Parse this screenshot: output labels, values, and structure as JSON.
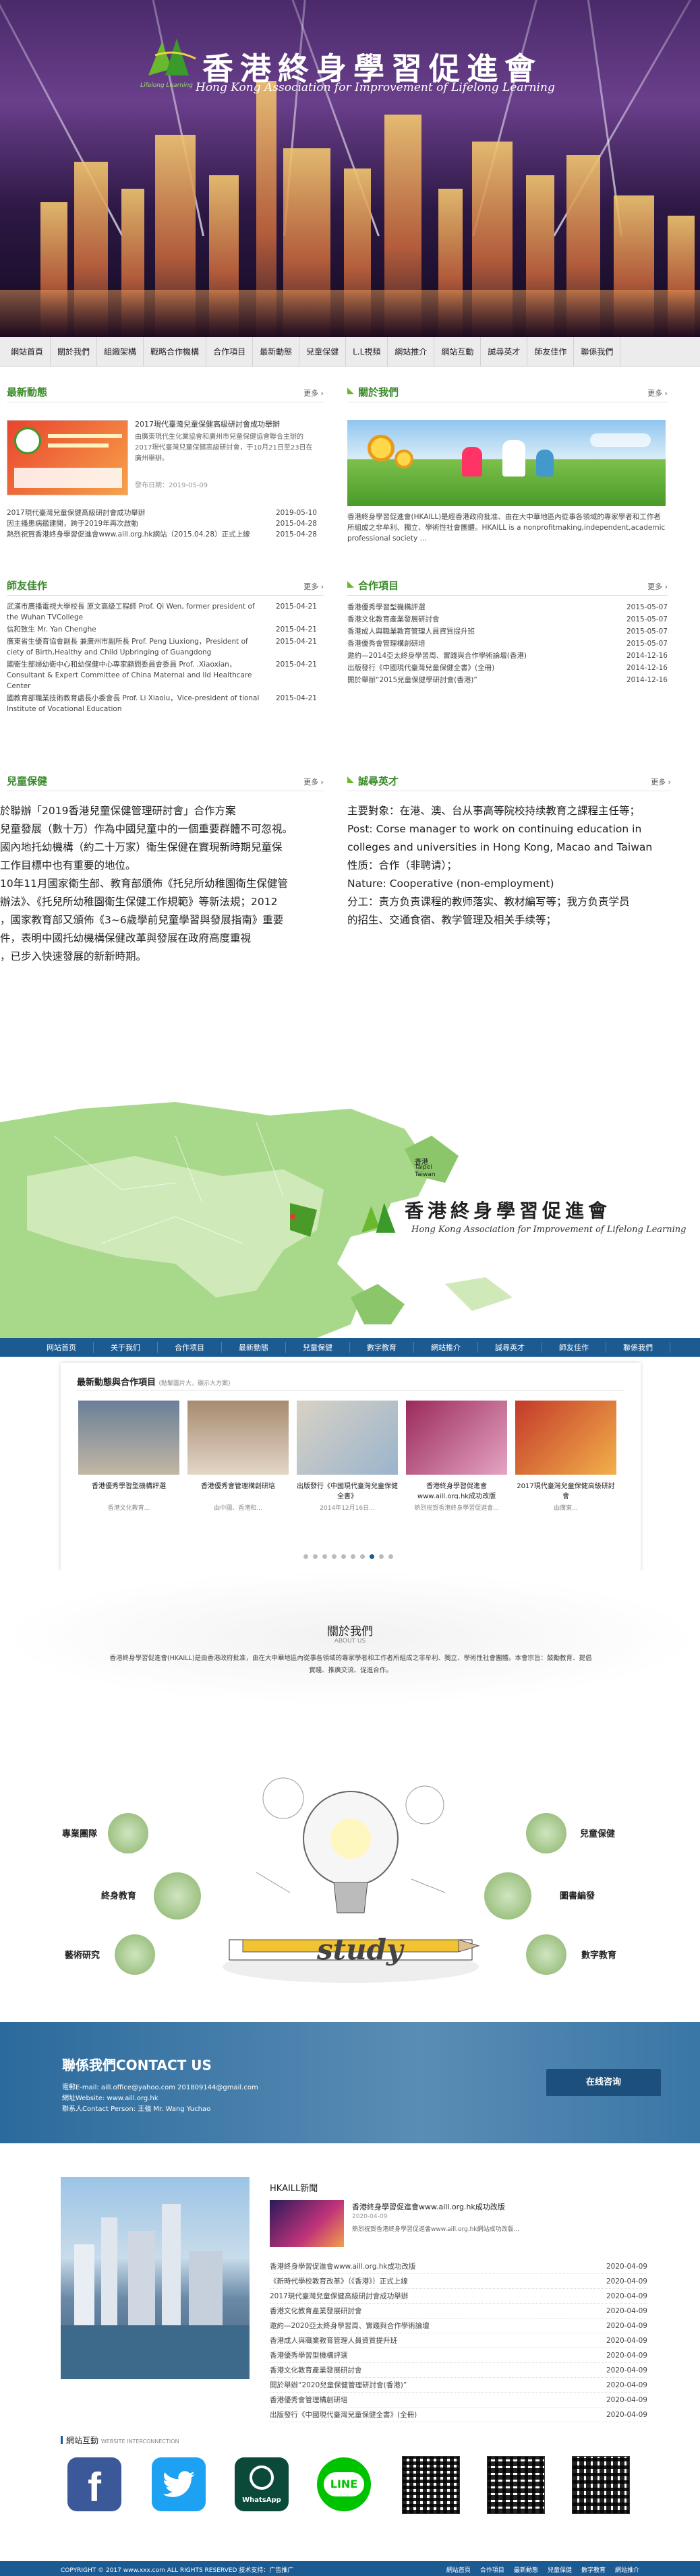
{
  "banner": {
    "title": "香港終身學習促進會",
    "subtitle": "Hong Kong Association for Improvement of Lifelong Learning",
    "logo_caption": "Lifelong Learning"
  },
  "nav": [
    "網站首頁",
    "關於我們",
    "組織架構",
    "戰略合作機構",
    "合作項目",
    "最新動態",
    "兒童保健",
    "L.L視頻",
    "網站推介",
    "網站互動",
    "誠尋英才",
    "師友佳作",
    "聯係我們"
  ],
  "sections": {
    "news": {
      "title": "最新動態",
      "more": "更多 ›",
      "feature_text": "2017現代臺灣兒童保健高級研討會成功舉辦",
      "feature_desc": "由廣東現代生化業協會和廣州市兒童保健協會聯合主辦的2017現代臺灣兒童保健高級研討會，于10月21日至23日在廣州舉辦。",
      "feature_date": "發布日期：2019-05-09",
      "items": [
        {
          "t": "2017現代臺灣兒童保健高級研討會成功舉辦",
          "d": "2019-05-10"
        },
        {
          "t": "因主播患病鑑建開，跨于2019年再次啟動",
          "d": "2015-04-28"
        },
        {
          "t": "熱烈祝賀香港終身學習促進會www.aill.org.hk網站（2015.04.28）正式上線",
          "d": "2015-04-28"
        }
      ]
    },
    "about": {
      "title": "關於我們",
      "more": "更多 ›",
      "text": "香港終身學習促進會(HKAILL)是經香港政府批准、由在大中華地區內從事各領域的專家學者和工作者所組成之非牟利、獨立、學術性社會團體。HKAILL is a nonprofitmaking,independent,academic professional society ..."
    },
    "friends": {
      "title": "師友佳作",
      "more": "更多 ›",
      "items": [
        {
          "t": "武漢市廣播電視大學校長 原文高級工程師 Prof. Qi Wen, former president of the Wuhan TVCollege",
          "d": "2015-04-21"
        },
        {
          "t": "信和致生 Mr. Yan Chenghe",
          "d": "2015-04-21"
        },
        {
          "t": "廣東省生優育協會副長 兼廣州市副所長 Prof. Peng Liuxiong，President of ciety of Birth,Healthy and Child Upbringing of Guangdong",
          "d": "2015-04-21"
        },
        {
          "t": "國衛生部婦幼衛中心和幼保健中心專家顧問委員會委員 Prof. .Xiaoxian，Consultant & Expert Committee of China Maternal and lld Healthcare Center",
          "d": "2015-04-21"
        },
        {
          "t": "國教育部職業技術教育處長小委會長 Prof. Li Xiaolu，Vice-president of tional Institute of Vocational Education",
          "d": "2015-04-21"
        }
      ]
    },
    "projects": {
      "title": "合作項目",
      "more": "更多 ›",
      "items": [
        {
          "t": "香港優秀學習型機構評選",
          "d": "2015-05-07"
        },
        {
          "t": "香港文化教育產業發展研討會",
          "d": "2015-05-07"
        },
        {
          "t": "香港成人與職業教育管理人員資質提升班",
          "d": "2015-05-07"
        },
        {
          "t": "香港優秀會管理構創研培",
          "d": "2015-05-07"
        },
        {
          "t": "邀約—2014亞太終身學習周、實踐與合作學術論壇(香港)",
          "d": "2014-12-16"
        },
        {
          "t": "出版發行《中國現代臺灣兒童保健全書》(全冊)",
          "d": "2014-12-16"
        },
        {
          "t": "開於舉辦“2015兒童保健學研討會(香港)”",
          "d": "2014-12-16"
        }
      ]
    },
    "health": {
      "title": "兒童保健",
      "more": "更多 ›",
      "text": "於聯辦「2019香港兒童保健管理研討會」合作方案\n兒童發展（數十万）作為中國兒童中的一個重要群體不可忽視。\n國內地托幼機構（約二十万家）衛生保健在實現新時期兒童保\n工作目標中也有重要的地位。\n10年11月國家衛生部、教育部頒佈《托兒所幼稚園衛生保健管\n辦法》、《托兒所幼稚園衛生保健工作規範》等新法規；2012\n，國家教育部又頒佈《3~6歲學前兒童學習與發展指南》重要\n件，表明中國托幼機構保健改革與發展在政府高度重視\n，已步入快速發展的新新時期。"
    },
    "talent": {
      "title": "誠尋英才",
      "more": "更多 ›",
      "text": "主要對象：在港、澳、台从事高等院校持续教育之課程主任等；\nPost: Corse manager to work on continuing education in\ncolleges and universities in Hong Kong, Macao and Taiwan\n性质：合作（非聘请）；\nNature: Cooperative (non-employment)\n分工：责方负责课程的教师落实、教材編写等；我方负责学员\n的招生、交通食宿、教学管理及相关手续等；"
    }
  },
  "map": {
    "title": "香港終身學習促進會",
    "subtitle": "Hong Kong Association for Improvement of Lifelong Learning",
    "labels": {
      "hk": "香港",
      "taipei": "Taipei",
      "taiwan": "Taiwan"
    }
  },
  "nav2": [
    "网站首页",
    "关于我们",
    "合作项目",
    "最新動態",
    "兒童保健",
    "數字教育",
    "網站推介",
    "誠尋英才",
    "師友佳作",
    "聯係我們"
  ],
  "newsbox": {
    "title": "最新動態與合作項目",
    "title_sub": "(點擊圖片大，顯示大方案)",
    "items": [
      {
        "t": "香港優秀學習型機構評選",
        "d": "香港文化教育..."
      },
      {
        "t": "香港優秀會管理構創研培",
        "d": "由中國、香港和..."
      },
      {
        "t": "出版發行《中國現代臺灣兒童保健全書》",
        "d": "2014年12月16日..."
      },
      {
        "t": "香港終身學習促進會www.aill.org.hk成功改版",
        "d": "熱烈祝賀香港終身學習促進會..."
      },
      {
        "t": "2017現代臺灣兒童保健高級研討會",
        "d": "由廣東..."
      }
    ]
  },
  "about2": {
    "title": "關於我們",
    "sub": "ABOUT US",
    "text": "香港終身學習促進會(HKAILL)是由香港政府批准，由在大中華地區內從事各領域的專家學者和工作者所組成之非牟利、獨立、學術性社會團體。本會宗旨：鼓勵教育、提倡實踐、推廣交流、促進合作。",
    "nodes": [
      "專業團隊",
      "兒童保健",
      "終身教育",
      "圖書編發",
      "藝術研究",
      "數字教育"
    ],
    "center": "study"
  },
  "contact": {
    "title": "聯係我們CONTACT US",
    "lines": [
      "電郵E-mail: aill.office@yahoo.com  201809144@gmail.com",
      "網址Website: www.aill.org.hk",
      "聯系人Contact Person: 王強 Mr. Wang Yuchao"
    ],
    "button": "在线咨询"
  },
  "hk_news": {
    "title": "HKAILL新聞",
    "feature": "香港終身學習促進會www.aill.org.hk成功改版",
    "feature_date": "2020-04-09",
    "feature_desc": "熱烈祝賀香港終身學習促進會www.aill.org.hk網站成功改版...",
    "items": [
      {
        "t": "香港終身學習促進會www.aill.org.hk成功改版",
        "d": "2020-04-09"
      },
      {
        "t": "《新時代學校教育改革》（《香港》）正式上線",
        "d": "2020-04-09"
      },
      {
        "t": "2017現代臺灣兒童保健高級研討會成功舉辦",
        "d": "2020-04-09"
      },
      {
        "t": "香港文化教育產業發展研討會",
        "d": "2020-04-09"
      },
      {
        "t": "邀約—2020亞太終身學習周、實踐與合作學術論壇",
        "d": "2020-04-09"
      },
      {
        "t": "香港成人與職業教育管理人員資質提升班",
        "d": "2020-04-09"
      },
      {
        "t": "香港優秀學習型機構評選",
        "d": "2020-04-09"
      },
      {
        "t": "香港文化教育產業發展研討會",
        "d": "2020-04-09"
      },
      {
        "t": "開於舉辦“2020兒童保健管理研討會(香港)”",
        "d": "2020-04-09"
      },
      {
        "t": "香港優秀會管理構創研培",
        "d": "2020-04-09"
      },
      {
        "t": "出版發行《中國現代臺灣兒童保健全書》(全冊)",
        "d": "2020-04-09"
      }
    ]
  },
  "links": {
    "title": "網站互動",
    "sub": "WEBSITE INTERCONNECTION",
    "whatsapp": "WhatsApp",
    "line": "LINE"
  },
  "footer": {
    "copy": "COPYRIGHT © 2017 www.xxx.com ALL RIGHTS RESERVED 技术支持：广告推广",
    "links": [
      "網站首頁",
      "合作項目",
      "最新動態",
      "兒童保健",
      "數字教育",
      "網站推介"
    ]
  },
  "colors": {
    "green": "#6ab82e",
    "blue": "#1c5a92",
    "dark_blue": "#2b6a9c"
  }
}
